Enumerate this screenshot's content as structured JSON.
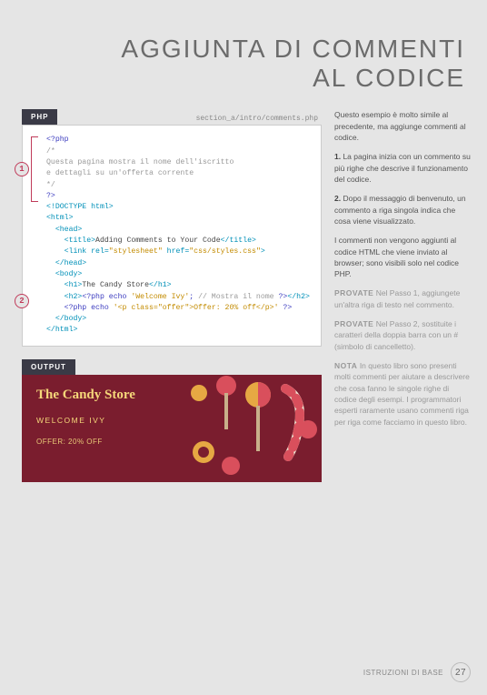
{
  "title_line1": "AGGIUNTA DI COMMENTI",
  "title_line2": "AL CODICE",
  "tab_php": "PHP",
  "file_path": "section_a/intro/comments.php",
  "code": {
    "l1": "<?php",
    "l2": "/*",
    "l3": "Questa pagina mostra il nome dell'iscritto",
    "l4": "e dettagli su un'offerta corrente",
    "l5": "*/",
    "l6": "?>",
    "l7": "<!DOCTYPE html>",
    "l8": "<html>",
    "l9": "  <head>",
    "l10a": "    <title>",
    "l10b": "Adding Comments to Your Code",
    "l10c": "</title>",
    "l11a": "    <link rel=",
    "l11b": "\"stylesheet\"",
    "l11c": " href=",
    "l11d": "\"css/styles.css\"",
    "l11e": ">",
    "l12": "  </head>",
    "l13": "  <body>",
    "l14a": "    <h1>",
    "l14b": "The Candy Store",
    "l14c": "</h1>",
    "l15a": "    <h2>",
    "l15b": "<?php echo ",
    "l15c": "'Welcome Ivy'",
    "l15d": "; ",
    "l15e": "// Mostra il nome ",
    "l15f": "?>",
    "l15g": "</h2>",
    "l16a": "    <?php echo ",
    "l16b": "'<p class=\"offer\">Offer: 20% off</p>'",
    "l16c": " ?>",
    "l17": "  </body>",
    "l18": "</html>"
  },
  "marker1": "1",
  "marker2": "2",
  "tab_output": "OUTPUT",
  "output": {
    "store": "The Candy Store",
    "welcome": "WELCOME IVY",
    "offer": "OFFER: 20% OFF"
  },
  "sidebar": {
    "p1": "Questo esempio è molto simile al precedente, ma aggiunge commenti al codice.",
    "p2a": "1.",
    "p2b": " La pagina inizia con un commento su più righe che descrive il funzionamento del codice.",
    "p3a": "2.",
    "p3b": " Dopo il messaggio di benvenuto, un commento a riga singola indica che cosa viene visualizzato.",
    "p4": "I commenti non vengono aggiunti al codice HTML che viene inviato al browser; sono visibili solo nel codice PHP.",
    "p5a": "PROVATE",
    "p5b": "  Nel Passo 1, aggiungete un'altra riga di testo nel commento.",
    "p6a": "PROVATE",
    "p6b": "  Nel Passo 2, sostituite i caratteri della doppia barra con un # (simbolo di cancelletto).",
    "p7a": "NOTA",
    "p7b": "  In questo libro sono presenti molti commenti per aiutare a descrivere che cosa fanno le singole righe di codice degli esempi. I programmatori esperti raramente usano commenti riga per riga come facciamo in questo libro."
  },
  "footer_label": "ISTRUZIONI DI BASE",
  "page_number": "27"
}
